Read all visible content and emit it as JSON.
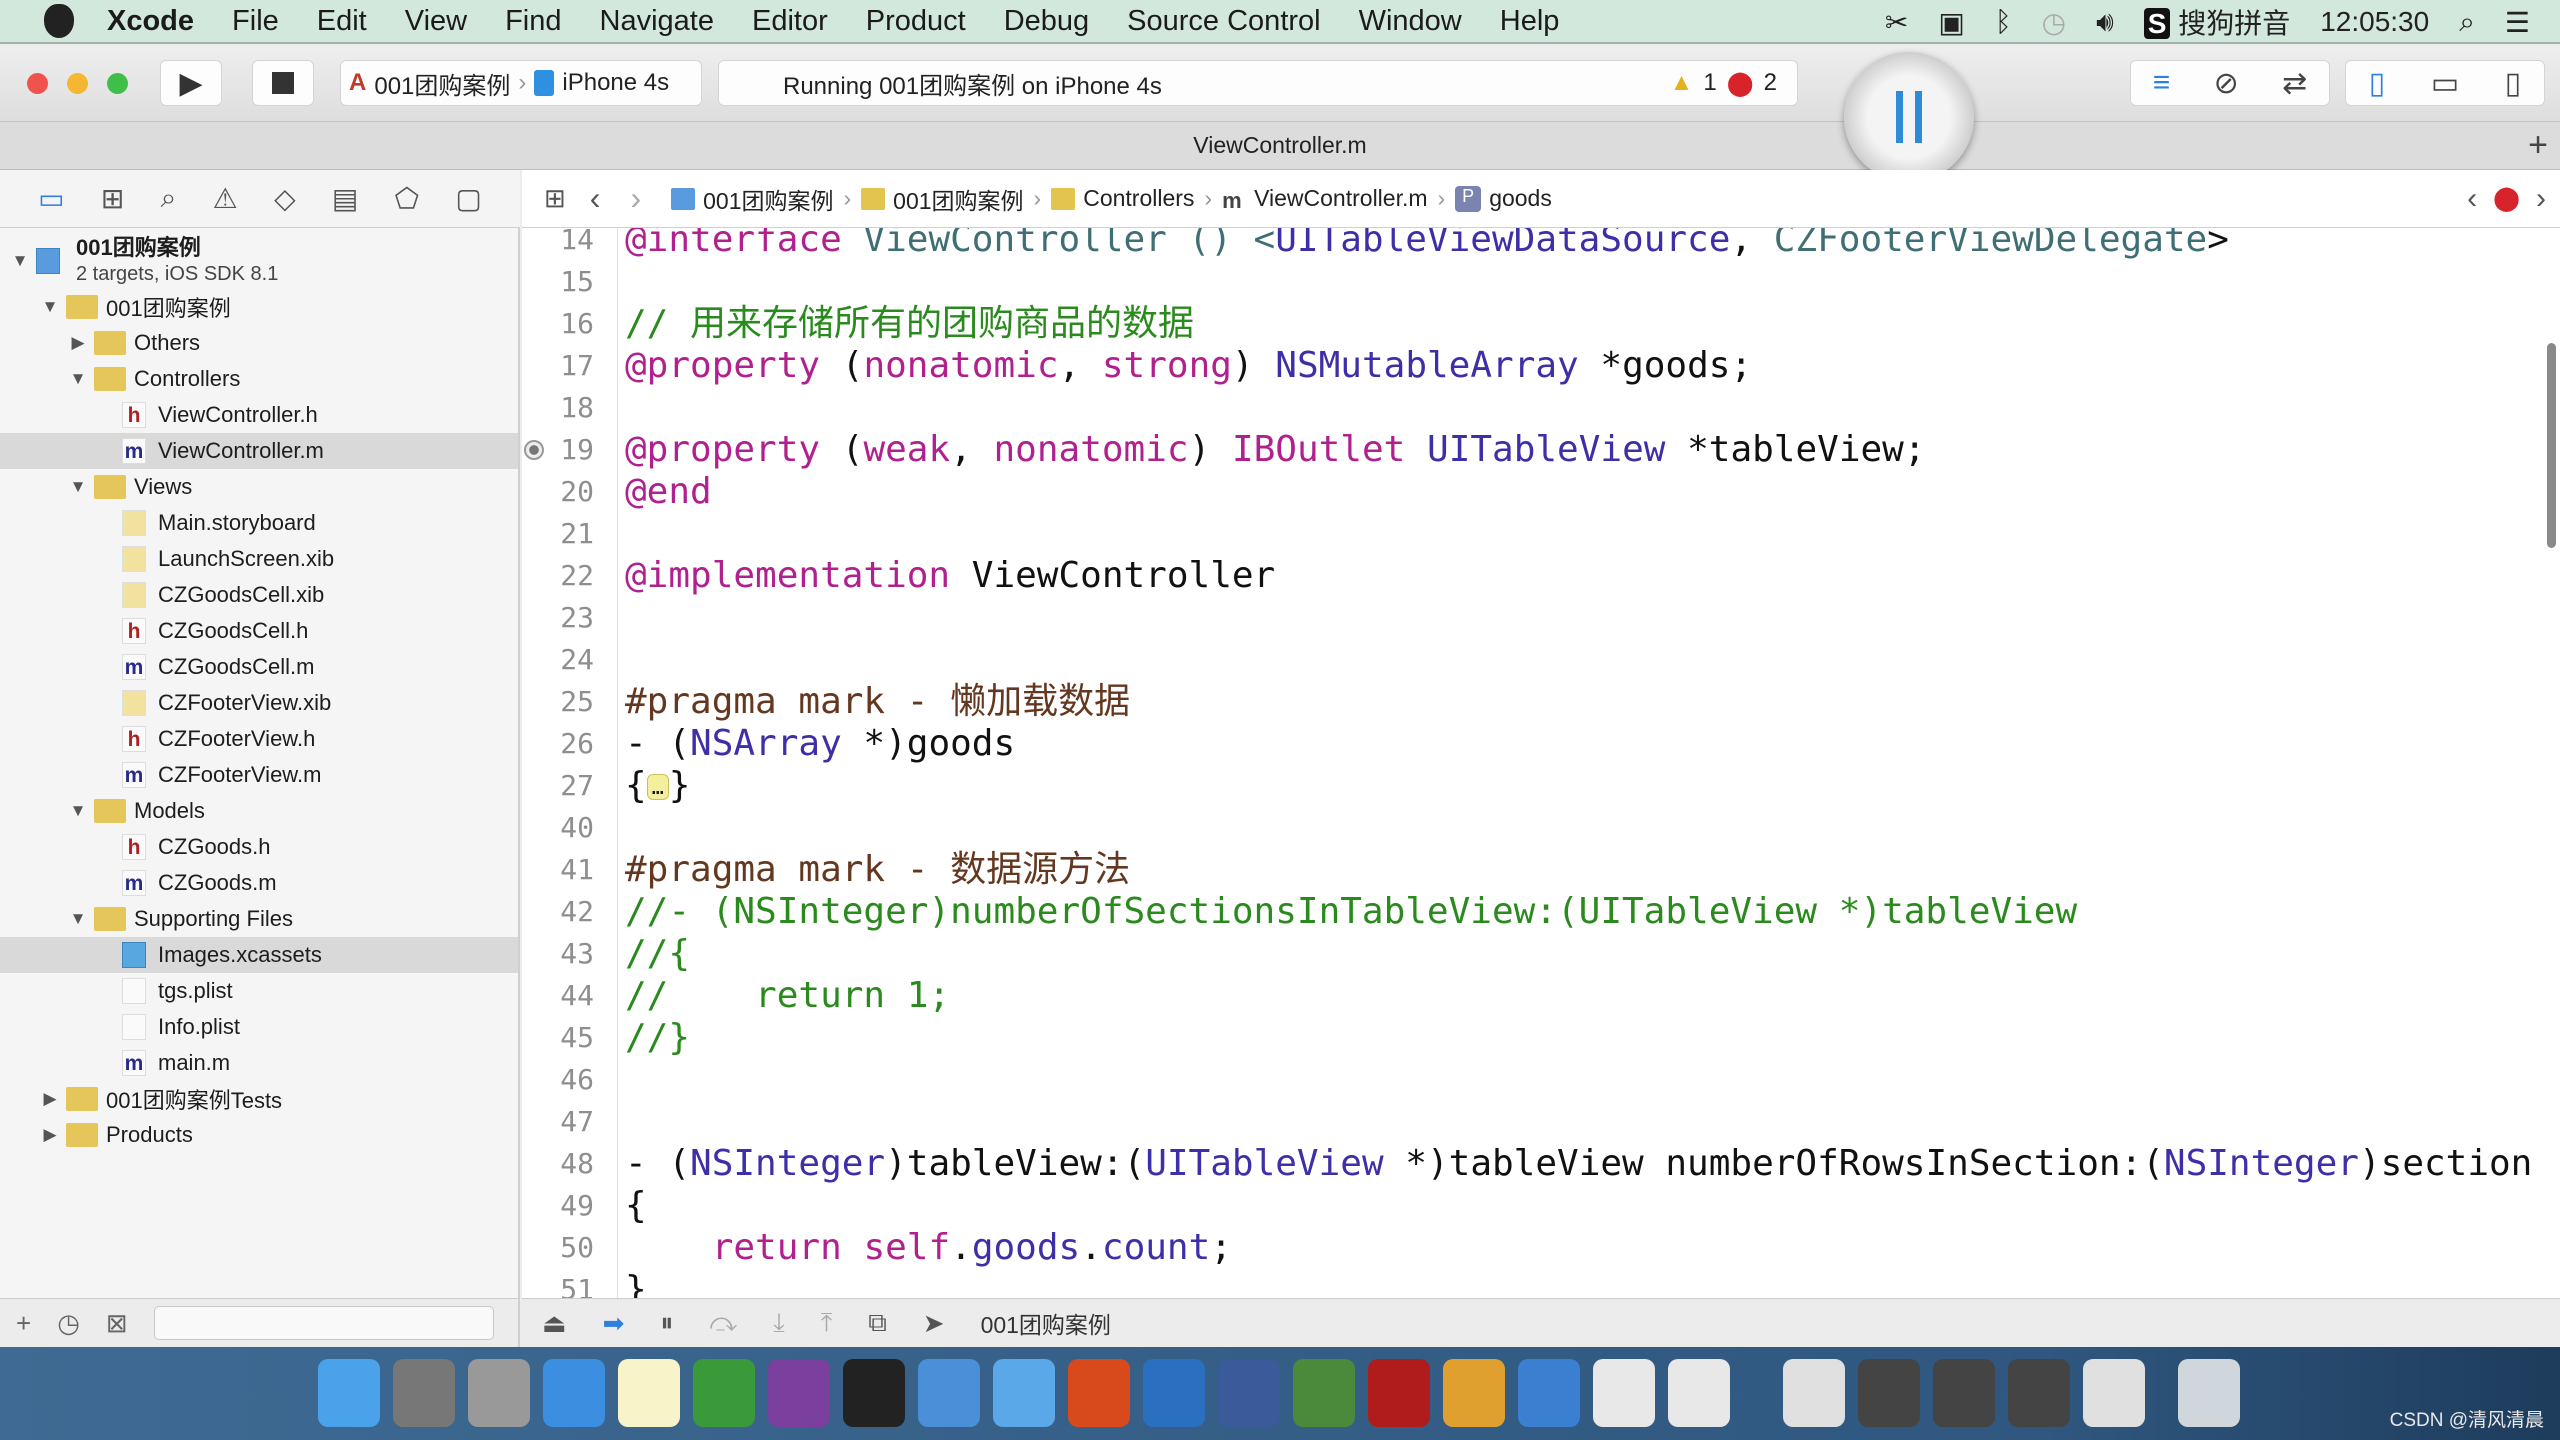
{
  "menubar": {
    "app": "Xcode",
    "items": [
      "File",
      "Edit",
      "View",
      "Find",
      "Navigate",
      "Editor",
      "Product",
      "Debug",
      "Source Control",
      "Window",
      "Help"
    ],
    "status_icons": [
      "scissors-icon",
      "camera-icon",
      "bluetooth-icon",
      "time-machine-icon",
      "volume-icon"
    ],
    "input_method": "搜狗拼音",
    "clock": "12:05:30"
  },
  "toolbar": {
    "scheme": "001团购案例",
    "device": "iPhone 4s",
    "status": "Running 001团购案例 on iPhone 4s",
    "warnings": "1",
    "errors": "2"
  },
  "tab": {
    "title": "ViewController.m"
  },
  "jumpbar": {
    "crumbs": [
      {
        "label": "001团购案例",
        "icon": "project"
      },
      {
        "label": "001团购案例",
        "icon": "folder"
      },
      {
        "label": "Controllers",
        "icon": "folder"
      },
      {
        "label": "ViewController.m",
        "icon": "m"
      },
      {
        "label": "goods",
        "icon": "p"
      }
    ]
  },
  "navigator": {
    "project": {
      "name": "001团购案例",
      "subtitle": "2 targets, iOS SDK 8.1"
    },
    "items": [
      {
        "label": "001团购案例",
        "level": 1,
        "type": "folder",
        "open": true
      },
      {
        "label": "Others",
        "level": 2,
        "type": "folder",
        "open": false
      },
      {
        "label": "Controllers",
        "level": 2,
        "type": "folder",
        "open": true
      },
      {
        "label": "ViewController.h",
        "level": 3,
        "type": "h"
      },
      {
        "label": "ViewController.m",
        "level": 3,
        "type": "m",
        "selected": true
      },
      {
        "label": "Views",
        "level": 2,
        "type": "folder",
        "open": true
      },
      {
        "label": "Main.storyboard",
        "level": 3,
        "type": "xib"
      },
      {
        "label": "LaunchScreen.xib",
        "level": 3,
        "type": "xib"
      },
      {
        "label": "CZGoodsCell.xib",
        "level": 3,
        "type": "xib"
      },
      {
        "label": "CZGoodsCell.h",
        "level": 3,
        "type": "h"
      },
      {
        "label": "CZGoodsCell.m",
        "level": 3,
        "type": "m"
      },
      {
        "label": "CZFooterView.xib",
        "level": 3,
        "type": "xib"
      },
      {
        "label": "CZFooterView.h",
        "level": 3,
        "type": "h"
      },
      {
        "label": "CZFooterView.m",
        "level": 3,
        "type": "m"
      },
      {
        "label": "Models",
        "level": 2,
        "type": "folder",
        "open": true
      },
      {
        "label": "CZGoods.h",
        "level": 3,
        "type": "h"
      },
      {
        "label": "CZGoods.m",
        "level": 3,
        "type": "m"
      },
      {
        "label": "Supporting Files",
        "level": 2,
        "type": "folder",
        "open": true
      },
      {
        "label": "Images.xcassets",
        "level": 3,
        "type": "assets",
        "selected": true
      },
      {
        "label": "tgs.plist",
        "level": 3,
        "type": "plist"
      },
      {
        "label": "Info.plist",
        "level": 3,
        "type": "plist"
      },
      {
        "label": "main.m",
        "level": 3,
        "type": "m"
      },
      {
        "label": "001团购案例Tests",
        "level": 1,
        "type": "folder",
        "open": false
      },
      {
        "label": "Products",
        "level": 1,
        "type": "folder",
        "open": false
      }
    ]
  },
  "editor": {
    "lines": [
      {
        "n": "14",
        "t": [
          [
            "@interface",
            "kw"
          ],
          [
            " ViewController () <",
            "prj"
          ],
          [
            "UITableViewDataSource",
            "cls"
          ],
          [
            ", ",
            "plain"
          ],
          [
            "CZFooterViewDelegate",
            "prj"
          ],
          [
            ">",
            "plain"
          ]
        ]
      },
      {
        "n": "15",
        "t": []
      },
      {
        "n": "16",
        "t": [
          [
            "// 用来存储所有的团购商品的数据",
            "cm"
          ]
        ]
      },
      {
        "n": "17",
        "t": [
          [
            "@property",
            "kw"
          ],
          [
            " (",
            "plain"
          ],
          [
            "nonatomic",
            "kw"
          ],
          [
            ", ",
            "plain"
          ],
          [
            "strong",
            "kw"
          ],
          [
            ") ",
            "plain"
          ],
          [
            "NSMutableArray",
            "cls"
          ],
          [
            " *goods;",
            "plain"
          ]
        ]
      },
      {
        "n": "18",
        "t": []
      },
      {
        "n": "19",
        "t": [
          [
            "@property",
            "kw"
          ],
          [
            " (",
            "plain"
          ],
          [
            "weak",
            "kw"
          ],
          [
            ", ",
            "plain"
          ],
          [
            "nonatomic",
            "kw"
          ],
          [
            ") ",
            "plain"
          ],
          [
            "IBOutlet",
            "kw"
          ],
          [
            " ",
            "plain"
          ],
          [
            "UITableView",
            "cls"
          ],
          [
            " *tableView;",
            "plain"
          ]
        ],
        "outlet": true
      },
      {
        "n": "20",
        "t": [
          [
            "@end",
            "kw"
          ]
        ]
      },
      {
        "n": "21",
        "t": []
      },
      {
        "n": "22",
        "t": [
          [
            "@implementation",
            "kw"
          ],
          [
            " ViewController",
            "plain"
          ]
        ]
      },
      {
        "n": "23",
        "t": []
      },
      {
        "n": "24",
        "t": []
      },
      {
        "n": "25",
        "t": [
          [
            "#pragma mark - 懒加载数据",
            "pr"
          ]
        ]
      },
      {
        "n": "26",
        "t": [
          [
            "- (",
            "plain"
          ],
          [
            "NSArray",
            "cls"
          ],
          [
            " *)goods",
            "plain"
          ]
        ]
      },
      {
        "n": "27",
        "t": [
          [
            "{",
            "plain"
          ],
          [
            "…",
            "fold"
          ],
          [
            "}",
            "plain"
          ]
        ]
      },
      {
        "n": "40",
        "t": []
      },
      {
        "n": "41",
        "t": [
          [
            "#pragma mark - 数据源方法",
            "pr"
          ]
        ]
      },
      {
        "n": "42",
        "t": [
          [
            "//- (NSInteger)numberOfSectionsInTableView:(UITableView *)tableView",
            "cm"
          ]
        ]
      },
      {
        "n": "43",
        "t": [
          [
            "//{",
            "cm"
          ]
        ]
      },
      {
        "n": "44",
        "t": [
          [
            "//    return 1;",
            "cm"
          ]
        ]
      },
      {
        "n": "45",
        "t": [
          [
            "//}",
            "cm"
          ]
        ]
      },
      {
        "n": "46",
        "t": []
      },
      {
        "n": "47",
        "t": []
      },
      {
        "n": "48",
        "t": [
          [
            "- (",
            "plain"
          ],
          [
            "NSInteger",
            "cls"
          ],
          [
            ")tableView:(",
            "plain"
          ],
          [
            "UITableView",
            "cls"
          ],
          [
            " *)tableView numberOfRowsInSection:(",
            "plain"
          ],
          [
            "NSInteger",
            "cls"
          ],
          [
            ")section",
            "plain"
          ]
        ]
      },
      {
        "n": "49",
        "t": [
          [
            "{",
            "plain"
          ]
        ]
      },
      {
        "n": "50",
        "t": [
          [
            "    ",
            "plain"
          ],
          [
            "return",
            "kw"
          ],
          [
            " ",
            "plain"
          ],
          [
            "self",
            "kw"
          ],
          [
            ".",
            "plain"
          ],
          [
            "goods",
            "cls"
          ],
          [
            ".",
            "plain"
          ],
          [
            "count",
            "cls"
          ],
          [
            ";",
            "plain"
          ]
        ]
      },
      {
        "n": "51",
        "t": [
          [
            "}",
            "plain"
          ]
        ]
      }
    ]
  },
  "debugbar": {
    "target": "001团购案例"
  },
  "dock": {
    "apps": [
      "finder",
      "system-preferences",
      "launchpad",
      "safari",
      "notes",
      "excel",
      "onenote",
      "terminal",
      "xcode",
      "folder",
      "powerpoint",
      "scissors",
      "photo-slideshow",
      "ftp-client",
      "filezilla",
      "instruments",
      "word",
      "preview",
      "preview",
      "document",
      "screen",
      "screen",
      "screen",
      "document",
      "trash"
    ]
  },
  "watermark": "CSDN @清风清晨",
  "colors": {
    "keyword": "#b0218f",
    "system_class": "#3d2fa8",
    "project_class": "#3f6e74",
    "comment": "#2b8a1e",
    "pragma": "#643820",
    "accent": "#2d7fe0"
  }
}
